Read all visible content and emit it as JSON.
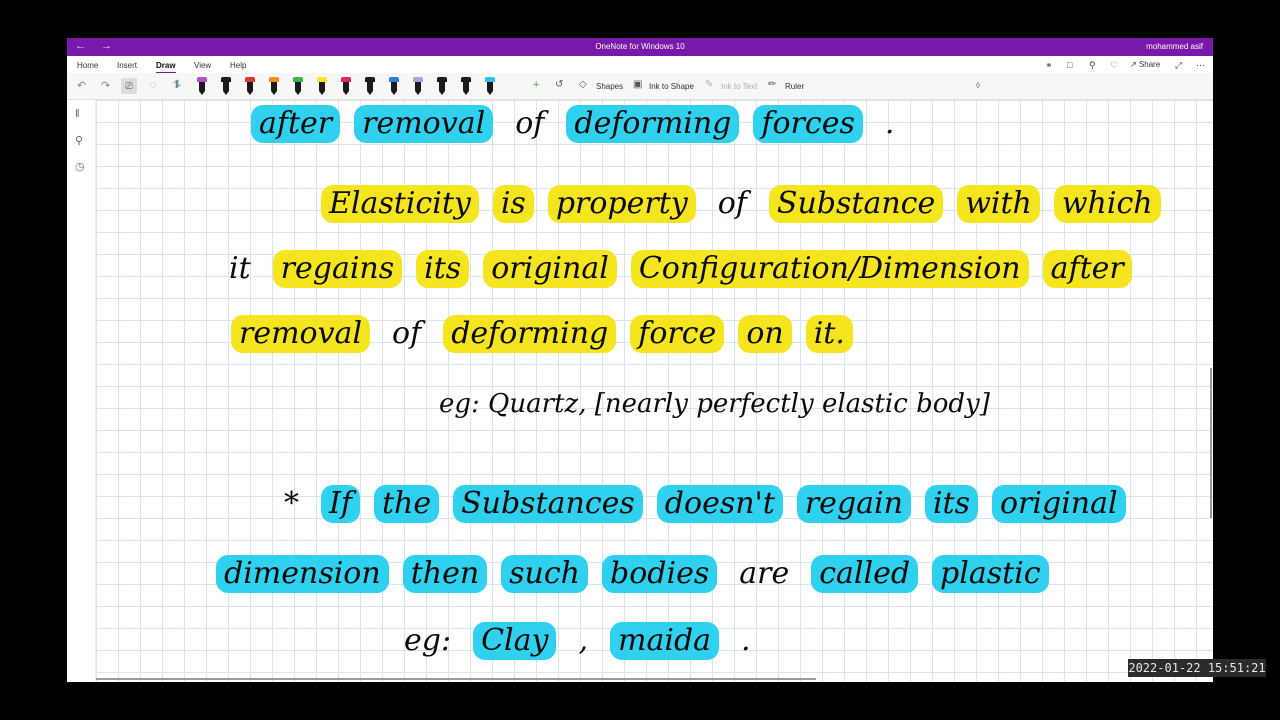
{
  "window": {
    "title": "OneNote for Windows 10",
    "user": "mohammed asif",
    "back_icon": "arrow-left-icon",
    "forward_icon": "arrow-right-icon"
  },
  "ribbon": {
    "tabs": [
      "Home",
      "Insert",
      "Draw",
      "View",
      "Help"
    ],
    "active_tab": "Draw",
    "share_label": "Share"
  },
  "toolbar": {
    "pens": [
      {
        "color": "#b14fc5"
      },
      {
        "color": "#1a1a1a"
      },
      {
        "color": "#e03a2e"
      },
      {
        "color": "#f28c1e"
      },
      {
        "color": "#3ab54a"
      },
      {
        "color": "#f5e51f"
      },
      {
        "color": "#e0245e"
      },
      {
        "color": "#1a1a1a"
      },
      {
        "color": "#2f7de1"
      },
      {
        "color": "#b99be0"
      },
      {
        "color": "#1a1a1a"
      },
      {
        "color": "#1a1a1a"
      },
      {
        "color": "#29c5e6"
      }
    ],
    "shapes_label": "Shapes",
    "ink_to_shape_label": "Ink to Shape",
    "ink_to_text_label": "Ink to Text",
    "ruler_label": "Ruler"
  },
  "note": {
    "lines": [
      {
        "words": [
          {
            "t": "after",
            "h": "c"
          },
          {
            "t": "removal",
            "h": "c"
          },
          {
            "t": "of",
            "h": "n"
          },
          {
            "t": "deforming",
            "h": "c"
          },
          {
            "t": "forces",
            "h": "c"
          },
          {
            "t": ".",
            "h": "n"
          }
        ]
      },
      {
        "words": [
          {
            "t": "Elasticity",
            "h": "y"
          },
          {
            "t": "is",
            "h": "y"
          },
          {
            "t": "property",
            "h": "y"
          },
          {
            "t": "of",
            "h": "n"
          },
          {
            "t": "Substance",
            "h": "y"
          },
          {
            "t": "with",
            "h": "y"
          },
          {
            "t": "which",
            "h": "y"
          }
        ]
      },
      {
        "words": [
          {
            "t": "it",
            "h": "n"
          },
          {
            "t": "regains",
            "h": "y"
          },
          {
            "t": "its",
            "h": "y"
          },
          {
            "t": "original",
            "h": "y"
          },
          {
            "t": "Configuration/Dimension",
            "h": "y"
          },
          {
            "t": "after",
            "h": "y"
          }
        ]
      },
      {
        "words": [
          {
            "t": "removal",
            "h": "y"
          },
          {
            "t": "of",
            "h": "n"
          },
          {
            "t": "deforming",
            "h": "y"
          },
          {
            "t": "force",
            "h": "y"
          },
          {
            "t": "on",
            "h": "y"
          },
          {
            "t": "it.",
            "h": "y"
          }
        ]
      },
      {
        "words": [
          {
            "t": "eg: Quartz, [nearly perfectly elastic body]",
            "h": "n"
          }
        ]
      },
      {
        "words": [
          {
            "t": "*",
            "h": "n"
          },
          {
            "t": "If",
            "h": "c"
          },
          {
            "t": "the",
            "h": "c"
          },
          {
            "t": "Substances",
            "h": "c"
          },
          {
            "t": "doesn't",
            "h": "c"
          },
          {
            "t": "regain",
            "h": "c"
          },
          {
            "t": "its",
            "h": "c"
          },
          {
            "t": "original",
            "h": "c"
          }
        ]
      },
      {
        "words": [
          {
            "t": "dimension",
            "h": "c"
          },
          {
            "t": "then",
            "h": "c"
          },
          {
            "t": "such",
            "h": "c"
          },
          {
            "t": "bodies",
            "h": "c"
          },
          {
            "t": "are",
            "h": "n"
          },
          {
            "t": "called",
            "h": "c"
          },
          {
            "t": "plastic",
            "h": "c"
          }
        ]
      },
      {
        "words": [
          {
            "t": "eg:",
            "h": "n"
          },
          {
            "t": "Clay",
            "h": "c"
          },
          {
            "t": ",",
            "h": "n"
          },
          {
            "t": "maida",
            "h": "c"
          },
          {
            "t": ".",
            "h": "n"
          }
        ]
      }
    ]
  },
  "timestamp": "2022-01-22 15:51:21"
}
